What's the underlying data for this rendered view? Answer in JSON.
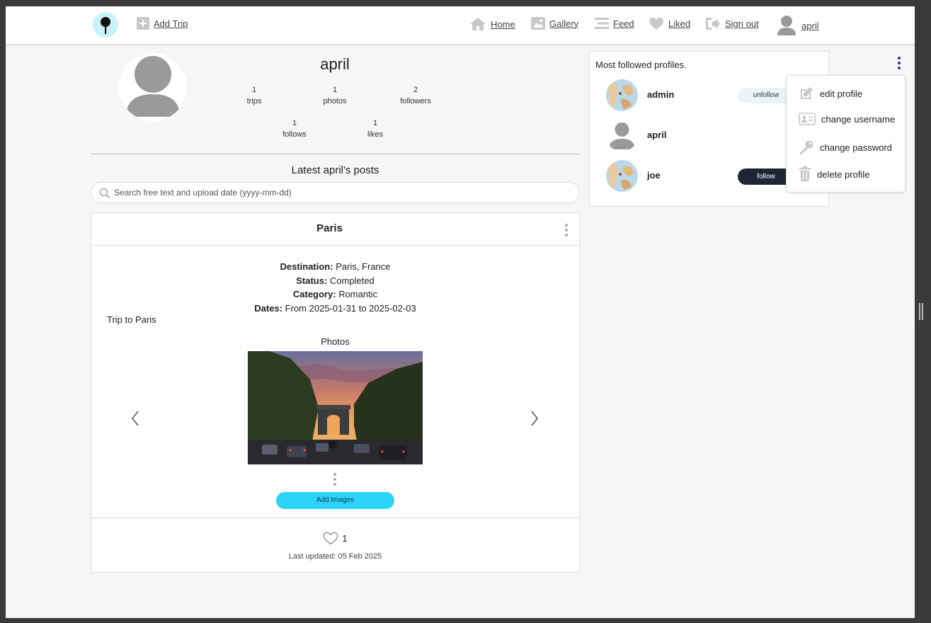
{
  "nav": {
    "add_trip": "Add Trip",
    "home": "Home",
    "gallery": "Gallery",
    "feed": "Feed",
    "liked": "Liked",
    "sign_out": "Sign out",
    "user": "april"
  },
  "profile": {
    "username": "april",
    "stats": [
      {
        "value": "1",
        "label": "trips"
      },
      {
        "value": "1",
        "label": "photos"
      },
      {
        "value": "2",
        "label": "followers"
      },
      {
        "value": "1",
        "label": "follows"
      },
      {
        "value": "1",
        "label": "likes"
      }
    ]
  },
  "posts_title": "Latest april's posts",
  "search": {
    "placeholder": "Search free text and upload date (yyyy-mm-dd)"
  },
  "post": {
    "title": "Paris",
    "details": [
      {
        "key": "Destination:",
        "value": "Paris, France"
      },
      {
        "key": "Status:",
        "value": "Completed"
      },
      {
        "key": "Category:",
        "value": "Romantic"
      },
      {
        "key": "Dates:",
        "value": "From 2025-01-31 to 2025-02-03"
      }
    ],
    "description": "Trip to Paris",
    "photos_label": "Photos",
    "add_images": "Add Images",
    "likes": "1",
    "last_updated": "Last updated: 05 Feb 2025"
  },
  "side_panel": {
    "title": "Most followed profiles.",
    "profiles": [
      {
        "name": "admin",
        "action": "unfollow"
      },
      {
        "name": "april",
        "action": ""
      },
      {
        "name": "joe",
        "action": "follow"
      }
    ]
  },
  "menu": {
    "items": [
      {
        "label": "edit profile",
        "icon": "edit-icon"
      },
      {
        "label": "change username",
        "icon": "id-card-icon"
      },
      {
        "label": "change password",
        "icon": "key-icon"
      },
      {
        "label": "delete profile",
        "icon": "trash-icon"
      }
    ]
  },
  "colors": {
    "accent": "#2bd3f6",
    "follow_button": "#1e2537",
    "kebab": "#2b3990"
  }
}
